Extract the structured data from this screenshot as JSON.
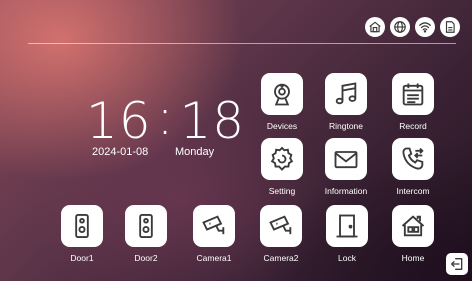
{
  "status_bar": {
    "icons": [
      "home-icon",
      "globe-icon",
      "wifi-icon",
      "sd-card-icon"
    ]
  },
  "clock": {
    "hours": "16",
    "separator": ":",
    "minutes": "18",
    "date": "2024-01-08",
    "weekday": "Monday"
  },
  "apps": {
    "devices": "Devices",
    "ringtone": "Ringtone",
    "record": "Record",
    "setting": "Setting",
    "information": "Information",
    "intercom": "Intercom"
  },
  "dock": {
    "door1": "Door1",
    "door2": "Door2",
    "camera1": "Camera1",
    "camera2": "Camera2",
    "lock": "Lock",
    "home": "Home"
  },
  "colors": {
    "icon_stroke": "#3a3a3a",
    "tile_background": "#ffffff",
    "text": "#ffffff"
  }
}
